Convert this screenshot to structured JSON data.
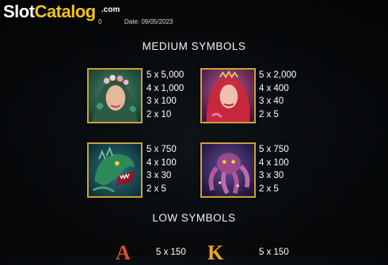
{
  "watermark": {
    "brand_slot": "Slot",
    "brand_catalog": "Catalog",
    "brand_com": ".com"
  },
  "header": {
    "time_fragment": "0",
    "date_text": "Date: 09/05/2023"
  },
  "medium": {
    "title": "MEDIUM SYMBOLS",
    "symbols": [
      {
        "icon": "flower-woman-icon",
        "pays": [
          "5 x 5,000",
          "4 x 1,000",
          "3 x 100",
          "2 x 10"
        ]
      },
      {
        "icon": "mermaid-icon",
        "pays": [
          "5 x 2,000",
          "4 x 400",
          "3 x 40",
          "2 x 5"
        ]
      },
      {
        "icon": "sea-dragon-icon",
        "pays": [
          "5 x 750",
          "4 x 100",
          "3 x 30",
          "2 x 5"
        ]
      },
      {
        "icon": "octopus-icon",
        "pays": [
          "5 x 750",
          "4 x 100",
          "3 x 30",
          "2 x 5"
        ]
      }
    ]
  },
  "low": {
    "title": "LOW SYMBOLS",
    "symbols": [
      {
        "letter": "A",
        "icon": "letter-a-icon",
        "pay": "5 x 150",
        "color": "#e0502a"
      },
      {
        "letter": "K",
        "icon": "letter-k-icon",
        "pay": "5 x 150",
        "color": "#f0a81c"
      }
    ]
  },
  "colors": {
    "frame_gold": "#c9a23a",
    "brand_yellow": "#f2c21b"
  }
}
